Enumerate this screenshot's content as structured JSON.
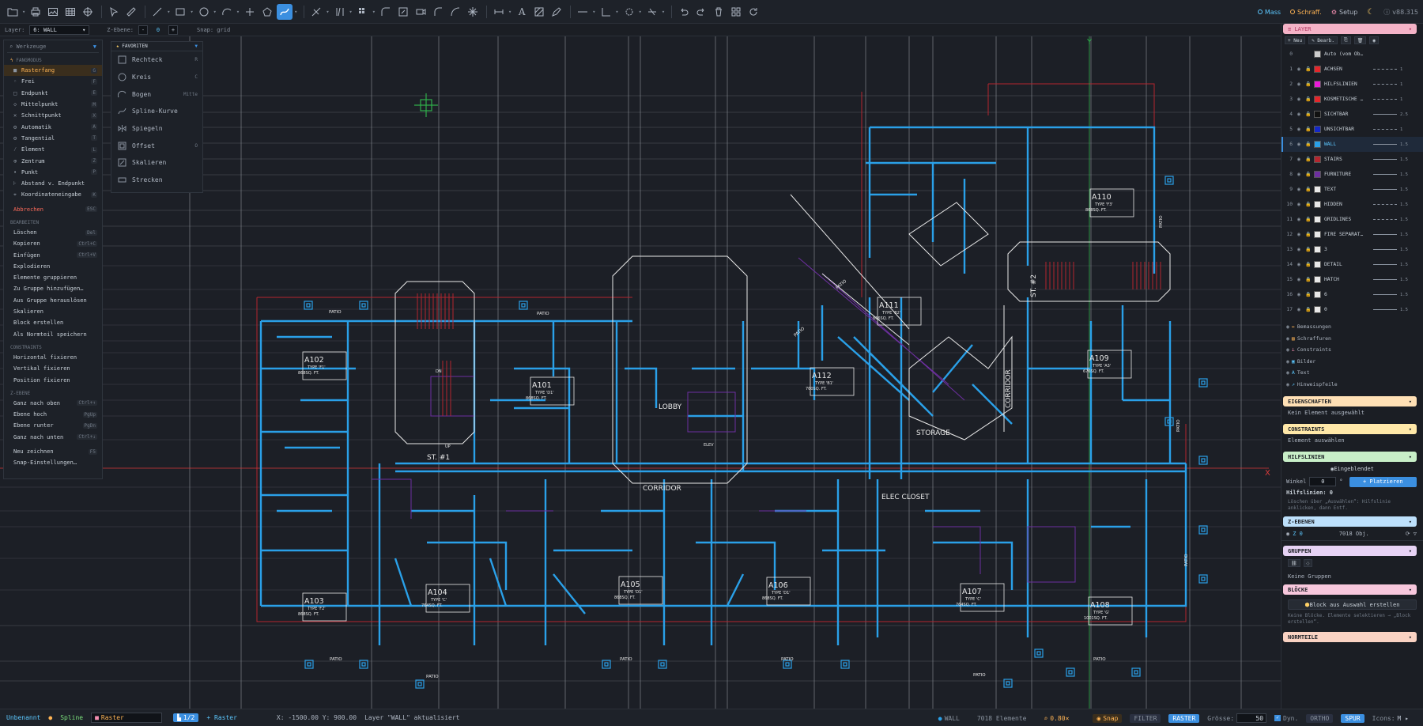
{
  "toolbar_right": {
    "mass": "Mass",
    "schraff": "Schraff.",
    "setup": "Setup",
    "version": "v88.315"
  },
  "subbar": {
    "layer_label": "Layer:",
    "layer_value": "6: WALL",
    "zebene_label": "Z-Ebene:",
    "zebene_minus": "-",
    "zebene_value": "0",
    "zebene_plus": "+",
    "snap_text": "Snap: grid"
  },
  "tool_menu": {
    "search_placeholder": "Werkzeuge",
    "fangmodus_label": "FANGMODUS",
    "snap_items": [
      {
        "label": "Rasterfang",
        "key": "G",
        "selected": true
      },
      {
        "label": "Frei",
        "key": "F"
      },
      {
        "label": "Endpunkt",
        "key": "E"
      },
      {
        "label": "Mittelpunkt",
        "key": "M"
      },
      {
        "label": "Schnittpunkt",
        "key": "X"
      },
      {
        "label": "Automatik",
        "key": "A"
      },
      {
        "label": "Tangential",
        "key": "T"
      },
      {
        "label": "Element",
        "key": "L"
      },
      {
        "label": "Zentrum",
        "key": "Z"
      },
      {
        "label": "Punkt",
        "key": "P"
      },
      {
        "label": "Abstand v. Endpunkt",
        "key": ""
      },
      {
        "label": "Koordinateneingabe",
        "key": "K"
      }
    ],
    "cancel_label": "Abbrechen",
    "cancel_key": "ESC",
    "bearbeiten_label": "BEARBEITEN",
    "edit_items": [
      {
        "label": "Löschen",
        "key": "Del"
      },
      {
        "label": "Kopieren",
        "key": "Ctrl+C"
      },
      {
        "label": "Einfügen",
        "key": "Ctrl+V"
      },
      {
        "label": "Explodieren",
        "key": ""
      },
      {
        "label": "Elemente gruppieren",
        "key": ""
      },
      {
        "label": "Zu Gruppe hinzufügen…",
        "key": ""
      },
      {
        "label": "Aus Gruppe herauslösen",
        "key": ""
      },
      {
        "label": "Skalieren",
        "key": ""
      },
      {
        "label": "Block erstellen",
        "key": ""
      },
      {
        "label": "Als Normteil speichern",
        "key": ""
      }
    ],
    "constraints_label": "CONSTRAINTS",
    "constraint_items": [
      {
        "label": "Horizontal fixieren",
        "key": ""
      },
      {
        "label": "Vertikal fixieren",
        "key": ""
      },
      {
        "label": "Position fixieren",
        "key": ""
      }
    ],
    "zebene_label": "Z-EBENE",
    "z_items": [
      {
        "label": "Ganz nach oben",
        "key": "Ctrl+↑"
      },
      {
        "label": "Ebene hoch",
        "key": "PgUp"
      },
      {
        "label": "Ebene runter",
        "key": "PgDn"
      },
      {
        "label": "Ganz nach unten",
        "key": "Ctrl+↓"
      }
    ],
    "redraw_label": "Neu zeichnen",
    "redraw_key": "F5",
    "snap_settings_label": "Snap-Einstellungen…"
  },
  "fav_menu": {
    "title": "FAVORITEN",
    "items": [
      {
        "label": "Rechteck",
        "key": "R",
        "icon": "rectangle-icon"
      },
      {
        "label": "Kreis",
        "key": "C",
        "icon": "circle-icon"
      },
      {
        "label": "Bogen",
        "key": "Mitte",
        "icon": "arc-icon"
      },
      {
        "label": "Spline-Kurve",
        "key": "",
        "icon": "spline-icon"
      },
      {
        "label": "Spiegeln",
        "key": "",
        "icon": "mirror-icon"
      },
      {
        "label": "Offset",
        "key": "O",
        "icon": "offset-icon"
      },
      {
        "label": "Skalieren",
        "key": "",
        "icon": "scale-icon"
      },
      {
        "label": "Strecken",
        "key": "",
        "icon": "stretch-icon"
      }
    ]
  },
  "floorplan_labels": {
    "rooms": [
      {
        "name": "A102",
        "type": "TYPE 'F1'",
        "area": "868SQ. FT."
      },
      {
        "name": "A101",
        "type": "TYPE 'D1'",
        "area": "868SQ. FT."
      },
      {
        "name": "A103",
        "type": "TYPE 'F2'",
        "area": "868SQ. FT."
      },
      {
        "name": "A104",
        "type": "TYPE 'C'",
        "area": "764SQ. FT."
      },
      {
        "name": "A105",
        "type": "TYPE 'D1'",
        "area": "868SQ. FT."
      },
      {
        "name": "A106",
        "type": "TYPE 'D1'",
        "area": "868SQ. FT."
      },
      {
        "name": "A107",
        "type": "TYPE 'C'",
        "area": "764SQ. FT."
      },
      {
        "name": "A108",
        "type": "TYPE 'G'",
        "area": "1001SQ. FT."
      },
      {
        "name": "A109",
        "type": "TYPE 'A3'",
        "area": "676SQ. FT."
      },
      {
        "name": "A110",
        "type": "TYPE 'F3'",
        "area": "868SQ. FT."
      },
      {
        "name": "A111",
        "type": "TYPE 'B2'",
        "area": "866SQ. FT."
      },
      {
        "name": "A112",
        "type": "TYPE 'B1'",
        "area": "760SQ. FT."
      }
    ],
    "lobby": "LOBBY",
    "corridor": "CORRIDOR",
    "corridor_vertical": "CORRIDOR",
    "storage": "STORAGE",
    "elec_closet": "ELEC CLOSET",
    "stair1": "ST. #1",
    "stair2": "ST. #2",
    "patio": "PATIO",
    "elev": "ELEV",
    "up": "UP",
    "dn": "DN",
    "axis_y": "Y",
    "axis_x": "X"
  },
  "right_panel": {
    "layer_header": "LAYER",
    "new_label": "+ Neu",
    "edit_label": "✎ Bearb.",
    "layers": [
      {
        "num": "0",
        "name": "Auto (vom Ob…",
        "color": "#cccccc",
        "line": "",
        "weight": ""
      },
      {
        "num": "1",
        "name": "ACHSEN",
        "color": "#e3262b",
        "line": "dash",
        "weight": "1"
      },
      {
        "num": "2",
        "name": "HILFSLINIEN",
        "color": "#ea1ad9",
        "line": "dash",
        "weight": "1"
      },
      {
        "num": "3",
        "name": "KOSMETISCHE …",
        "color": "#e3262b",
        "line": "dash",
        "weight": "1"
      },
      {
        "num": "4",
        "name": "SICHTBAR",
        "color": "#111111",
        "line": "solid",
        "weight": "2.5"
      },
      {
        "num": "5",
        "name": "UNSICHTBAR",
        "color": "#1428c8",
        "line": "dash",
        "weight": "1"
      },
      {
        "num": "6",
        "name": "WALL",
        "color": "#2aa0e8",
        "line": "solid",
        "weight": "1.5",
        "active": true
      },
      {
        "num": "7",
        "name": "STAIRS",
        "color": "#b3262f",
        "line": "solid",
        "weight": "1.5"
      },
      {
        "num": "8",
        "name": "FURNITURE",
        "color": "#6d2fa0",
        "line": "solid",
        "weight": "1.5"
      },
      {
        "num": "9",
        "name": "TEXT",
        "color": "#e8e8e8",
        "line": "solid",
        "weight": "1.5"
      },
      {
        "num": "10",
        "name": "HIDDEN",
        "color": "#e8e8e8",
        "line": "dash",
        "weight": "1.5"
      },
      {
        "num": "11",
        "name": "GRIDLINES",
        "color": "#e8e8e8",
        "line": "dash",
        "weight": "1.5"
      },
      {
        "num": "12",
        "name": "FIRE SEPARAT…",
        "color": "#e8e8e8",
        "line": "solid",
        "weight": "1.5"
      },
      {
        "num": "13",
        "name": "3",
        "color": "#e8e8e8",
        "line": "solid",
        "weight": "1.5"
      },
      {
        "num": "14",
        "name": "DETAIL",
        "color": "#e8e8e8",
        "line": "solid",
        "weight": "1.5"
      },
      {
        "num": "15",
        "name": "HATCH",
        "color": "#e8e8e8",
        "line": "solid",
        "weight": "1.5"
      },
      {
        "num": "16",
        "name": "6",
        "color": "#e8e8e8",
        "line": "solid",
        "weight": "1.5"
      },
      {
        "num": "17",
        "name": "0",
        "color": "#e8e8e8",
        "line": "solid",
        "weight": "1.5"
      }
    ],
    "toggles": [
      "Bemassungen",
      "Schraffuren",
      "Constraints",
      "Bilder",
      "Text",
      "Hinweispfeile"
    ],
    "eigenschaften_header": "EIGENSCHAFTEN",
    "eigenschaften_note": "Kein Element ausgewählt",
    "constraints_header": "CONSTRAINTS",
    "constraints_note": "Element auswählen",
    "hilfslinien_header": "HILFSLINIEN",
    "eingeblendet_label": "Eingeblendet",
    "winkel_label": "Winkel",
    "winkel_value": "0",
    "winkel_unit": "°",
    "platzieren_label": "+ Platzieren",
    "hilfslinien_count": "Hilfslinien: 0",
    "hilfslinien_note": "Löschen über „Auswählen“: Hilfslinie anklicken, dann Entf.",
    "zebenen_header": "Z-EBENEN",
    "zebenen_row": "Z 0",
    "zebenen_count": "7018 Obj.",
    "gruppen_header": "GRUPPEN",
    "gruppen_note": "Keine Gruppen",
    "bloecke_header": "BLÖCKE",
    "block_btn": "Block aus Auswahl erstellen",
    "bloecke_note": "Keine Blöcke. Elemente selektieren → „Block erstellen“.",
    "normteile_header": "NORMTEILE"
  },
  "statusbar": {
    "file": "Unbenannt",
    "tool": "Spline",
    "raster_select": "Raster",
    "ratio": "1/2",
    "raster_toggle": "+ Raster",
    "coords": "X: -1500.00 Y: 900.00",
    "message": "Layer \"WALL\" aktualisiert",
    "layer": "WALL",
    "elements": "7018 Elemente",
    "zoom": "0.80×",
    "snap": "Snap",
    "filter": "FILTER",
    "raster": "RASTER",
    "groesse_label": "Grösse:",
    "groesse_value": "50",
    "dyn": "Dyn.",
    "ortho": "ORTHO",
    "spur": "SPUR",
    "icons": "Icons:"
  }
}
